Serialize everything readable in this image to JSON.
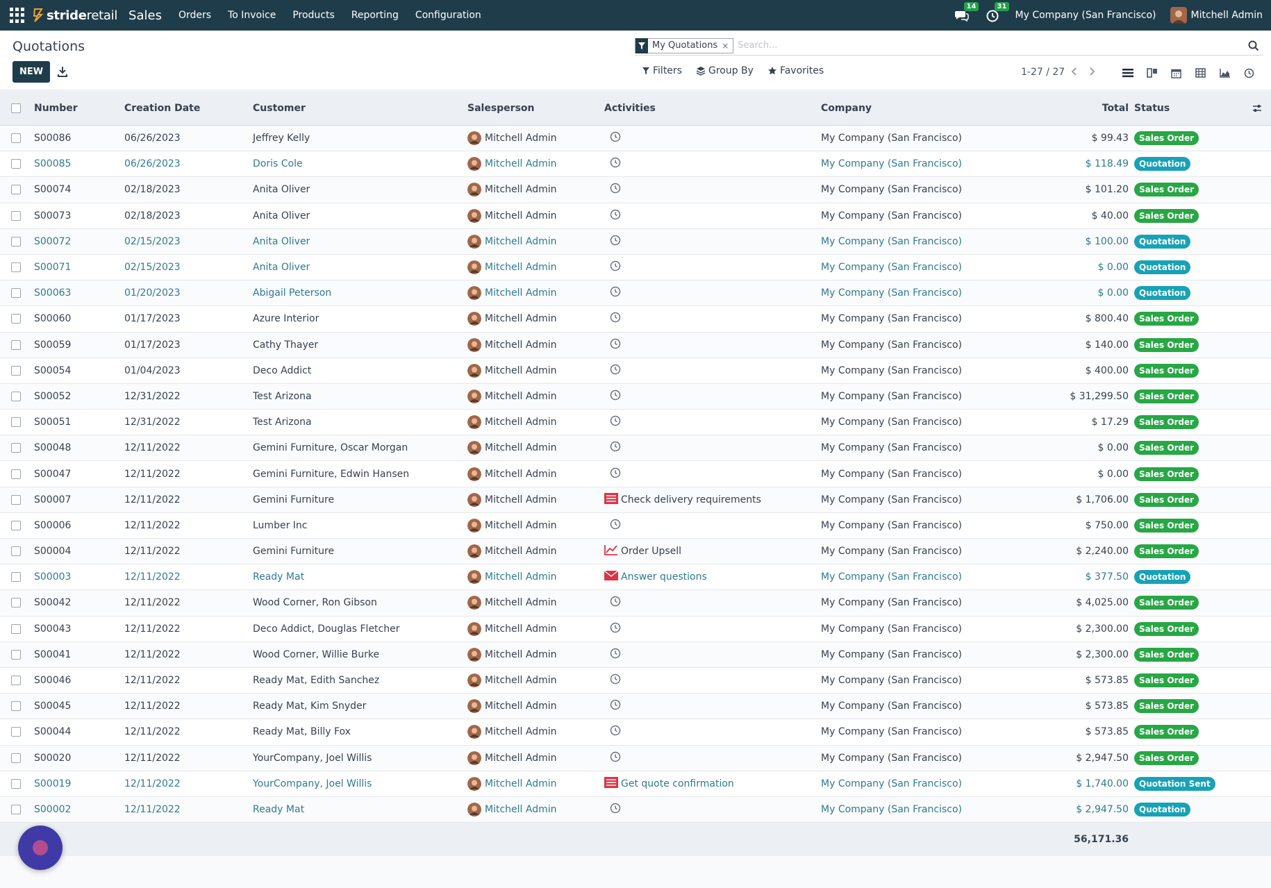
{
  "navbar": {
    "brand_a": "stride",
    "brand_b": "retail",
    "app": "Sales",
    "menu": [
      "Orders",
      "To Invoice",
      "Products",
      "Reporting",
      "Configuration"
    ],
    "messages_count": "14",
    "activities_count": "31",
    "company": "My Company (San Francisco)",
    "user": "Mitchell Admin"
  },
  "control": {
    "title": "Quotations",
    "new_label": "NEW",
    "facet": "My Quotations",
    "facet_remove": "×",
    "search_placeholder": "Search...",
    "filters": "Filters",
    "group_by": "Group By",
    "favorites": "Favorites",
    "pager": "1-27 / 27"
  },
  "colors": {
    "brand": "#1f3c4a",
    "sales_order": "#28a745",
    "quotation": "#17a2b8",
    "draft_link": "#2f7a93"
  },
  "table": {
    "headers": {
      "number": "Number",
      "date": "Creation Date",
      "customer": "Customer",
      "salesperson": "Salesperson",
      "activities": "Activities",
      "company": "Company",
      "total": "Total",
      "status": "Status"
    },
    "rows": [
      {
        "number": "S00086",
        "date": "06/26/2023",
        "customer": "Jeffrey Kelly",
        "salesperson": "Mitchell Admin",
        "activity": "",
        "activity_icon": "clock-icon",
        "company": "My Company (San Francisco)",
        "total": "$ 99.43",
        "status": "Sales Order",
        "draft": false
      },
      {
        "number": "S00085",
        "date": "06/26/2023",
        "customer": "Doris Cole",
        "salesperson": "Mitchell Admin",
        "activity": "",
        "activity_icon": "clock-icon",
        "company": "My Company (San Francisco)",
        "total": "$ 118.49",
        "status": "Quotation",
        "draft": true
      },
      {
        "number": "S00074",
        "date": "02/18/2023",
        "customer": "Anita Oliver",
        "salesperson": "Mitchell Admin",
        "activity": "",
        "activity_icon": "clock-icon",
        "company": "My Company (San Francisco)",
        "total": "$ 101.20",
        "status": "Sales Order",
        "draft": false
      },
      {
        "number": "S00073",
        "date": "02/18/2023",
        "customer": "Anita Oliver",
        "salesperson": "Mitchell Admin",
        "activity": "",
        "activity_icon": "clock-icon",
        "company": "My Company (San Francisco)",
        "total": "$ 40.00",
        "status": "Sales Order",
        "draft": false
      },
      {
        "number": "S00072",
        "date": "02/15/2023",
        "customer": "Anita Oliver",
        "salesperson": "Mitchell Admin",
        "activity": "",
        "activity_icon": "clock-icon",
        "company": "My Company (San Francisco)",
        "total": "$ 100.00",
        "status": "Quotation",
        "draft": true
      },
      {
        "number": "S00071",
        "date": "02/15/2023",
        "customer": "Anita Oliver",
        "salesperson": "Mitchell Admin",
        "activity": "",
        "activity_icon": "clock-icon",
        "company": "My Company (San Francisco)",
        "total": "$ 0.00",
        "status": "Quotation",
        "draft": true
      },
      {
        "number": "S00063",
        "date": "01/20/2023",
        "customer": "Abigail Peterson",
        "salesperson": "Mitchell Admin",
        "activity": "",
        "activity_icon": "clock-icon",
        "company": "My Company (San Francisco)",
        "total": "$ 0.00",
        "status": "Quotation",
        "draft": true
      },
      {
        "number": "S00060",
        "date": "01/17/2023",
        "customer": "Azure Interior",
        "salesperson": "Mitchell Admin",
        "activity": "",
        "activity_icon": "clock-icon",
        "company": "My Company (San Francisco)",
        "total": "$ 800.40",
        "status": "Sales Order",
        "draft": false
      },
      {
        "number": "S00059",
        "date": "01/17/2023",
        "customer": "Cathy Thayer",
        "salesperson": "Mitchell Admin",
        "activity": "",
        "activity_icon": "clock-icon",
        "company": "My Company (San Francisco)",
        "total": "$ 140.00",
        "status": "Sales Order",
        "draft": false
      },
      {
        "number": "S00054",
        "date": "01/04/2023",
        "customer": "Deco Addict",
        "salesperson": "Mitchell Admin",
        "activity": "",
        "activity_icon": "clock-icon",
        "company": "My Company (San Francisco)",
        "total": "$ 400.00",
        "status": "Sales Order",
        "draft": false
      },
      {
        "number": "S00052",
        "date": "12/31/2022",
        "customer": "Test Arizona",
        "salesperson": "Mitchell Admin",
        "activity": "",
        "activity_icon": "clock-icon",
        "company": "My Company (San Francisco)",
        "total": "$ 31,299.50",
        "status": "Sales Order",
        "draft": false
      },
      {
        "number": "S00051",
        "date": "12/31/2022",
        "customer": "Test Arizona",
        "salesperson": "Mitchell Admin",
        "activity": "",
        "activity_icon": "clock-icon",
        "company": "My Company (San Francisco)",
        "total": "$ 17.29",
        "status": "Sales Order",
        "draft": false
      },
      {
        "number": "S00048",
        "date": "12/11/2022",
        "customer": "Gemini Furniture, Oscar Morgan",
        "salesperson": "Mitchell Admin",
        "activity": "",
        "activity_icon": "clock-icon",
        "company": "My Company (San Francisco)",
        "total": "$ 0.00",
        "status": "Sales Order",
        "draft": false
      },
      {
        "number": "S00047",
        "date": "12/11/2022",
        "customer": "Gemini Furniture, Edwin Hansen",
        "salesperson": "Mitchell Admin",
        "activity": "",
        "activity_icon": "clock-icon",
        "company": "My Company (San Francisco)",
        "total": "$ 0.00",
        "status": "Sales Order",
        "draft": false
      },
      {
        "number": "S00007",
        "date": "12/11/2022",
        "customer": "Gemini Furniture",
        "salesperson": "Mitchell Admin",
        "activity": "Check delivery requirements",
        "activity_icon": "tasks-icon",
        "company": "My Company (San Francisco)",
        "total": "$ 1,706.00",
        "status": "Sales Order",
        "draft": false
      },
      {
        "number": "S00006",
        "date": "12/11/2022",
        "customer": "Lumber Inc",
        "salesperson": "Mitchell Admin",
        "activity": "",
        "activity_icon": "clock-icon",
        "company": "My Company (San Francisco)",
        "total": "$ 750.00",
        "status": "Sales Order",
        "draft": false
      },
      {
        "number": "S00004",
        "date": "12/11/2022",
        "customer": "Gemini Furniture",
        "salesperson": "Mitchell Admin",
        "activity": "Order Upsell",
        "activity_icon": "chart-icon",
        "company": "My Company (San Francisco)",
        "total": "$ 2,240.00",
        "status": "Sales Order",
        "draft": false
      },
      {
        "number": "S00003",
        "date": "12/11/2022",
        "customer": "Ready Mat",
        "salesperson": "Mitchell Admin",
        "activity": "Answer questions",
        "activity_icon": "envelope-icon",
        "company": "My Company (San Francisco)",
        "total": "$ 377.50",
        "status": "Quotation",
        "draft": true
      },
      {
        "number": "S00042",
        "date": "12/11/2022",
        "customer": "Wood Corner, Ron Gibson",
        "salesperson": "Mitchell Admin",
        "activity": "",
        "activity_icon": "clock-icon",
        "company": "My Company (San Francisco)",
        "total": "$ 4,025.00",
        "status": "Sales Order",
        "draft": false
      },
      {
        "number": "S00043",
        "date": "12/11/2022",
        "customer": "Deco Addict, Douglas Fletcher",
        "salesperson": "Mitchell Admin",
        "activity": "",
        "activity_icon": "clock-icon",
        "company": "My Company (San Francisco)",
        "total": "$ 2,300.00",
        "status": "Sales Order",
        "draft": false
      },
      {
        "number": "S00041",
        "date": "12/11/2022",
        "customer": "Wood Corner, Willie Burke",
        "salesperson": "Mitchell Admin",
        "activity": "",
        "activity_icon": "clock-icon",
        "company": "My Company (San Francisco)",
        "total": "$ 2,300.00",
        "status": "Sales Order",
        "draft": false
      },
      {
        "number": "S00046",
        "date": "12/11/2022",
        "customer": "Ready Mat, Edith Sanchez",
        "salesperson": "Mitchell Admin",
        "activity": "",
        "activity_icon": "clock-icon",
        "company": "My Company (San Francisco)",
        "total": "$ 573.85",
        "status": "Sales Order",
        "draft": false
      },
      {
        "number": "S00045",
        "date": "12/11/2022",
        "customer": "Ready Mat, Kim Snyder",
        "salesperson": "Mitchell Admin",
        "activity": "",
        "activity_icon": "clock-icon",
        "company": "My Company (San Francisco)",
        "total": "$ 573.85",
        "status": "Sales Order",
        "draft": false
      },
      {
        "number": "S00044",
        "date": "12/11/2022",
        "customer": "Ready Mat, Billy Fox",
        "salesperson": "Mitchell Admin",
        "activity": "",
        "activity_icon": "clock-icon",
        "company": "My Company (San Francisco)",
        "total": "$ 573.85",
        "status": "Sales Order",
        "draft": false
      },
      {
        "number": "S00020",
        "date": "12/11/2022",
        "customer": "YourCompany, Joel Willis",
        "salesperson": "Mitchell Admin",
        "activity": "",
        "activity_icon": "clock-icon",
        "company": "My Company (San Francisco)",
        "total": "$ 2,947.50",
        "status": "Sales Order",
        "draft": false
      },
      {
        "number": "S00019",
        "date": "12/11/2022",
        "customer": "YourCompany, Joel Willis",
        "salesperson": "Mitchell Admin",
        "activity": "Get quote confirmation",
        "activity_icon": "tasks-icon",
        "company": "My Company (San Francisco)",
        "total": "$ 1,740.00",
        "status": "Quotation Sent",
        "draft": true
      },
      {
        "number": "S00002",
        "date": "12/11/2022",
        "customer": "Ready Mat",
        "salesperson": "Mitchell Admin",
        "activity": "",
        "activity_icon": "clock-icon",
        "company": "My Company (San Francisco)",
        "total": "$ 2,947.50",
        "status": "Quotation",
        "draft": true
      }
    ],
    "grand_total": "56,171.36"
  }
}
